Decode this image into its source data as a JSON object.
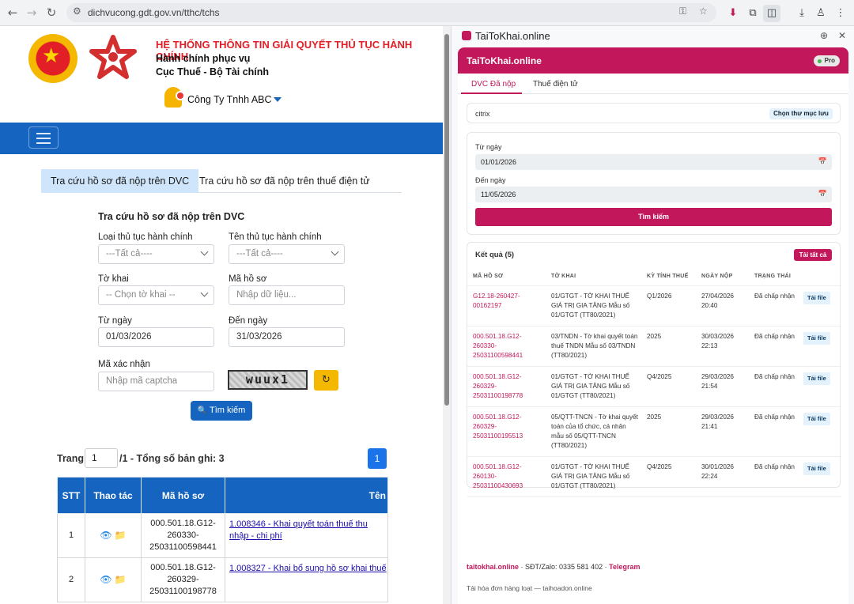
{
  "browser": {
    "url": "dichvucong.gdt.gov.vn/tthc/tchs"
  },
  "site": {
    "title": "HỆ THỐNG THÔNG TIN GIẢI QUYẾT THỦ TỤC HÀNH CHÍNH",
    "subtitle": "Hành chính phục vụ",
    "org": "Cục Thuế - Bộ Tài chính",
    "company": "Công Ty Tnhh ABC",
    "emblem_star": "★"
  },
  "tabs": {
    "tab1": "Tra cứu hồ sơ đã nộp trên DVC",
    "tab2": "Tra cứu hồ sơ đã nộp trên thuế điện tử"
  },
  "form": {
    "title": "Tra cứu hồ sơ đã nộp trên DVC",
    "loai_label": "Loại thủ tục hành chính",
    "loai_value": "---Tất cả----",
    "ten_label": "Tên thủ tục hành chính",
    "ten_value": "---Tất cả----",
    "tokhai_label": "Tờ khai",
    "tokhai_value": "-- Chọn tờ khai --",
    "mahs_label": "Mã hồ sơ",
    "mahs_placeholder": "Nhập dữ liệu...",
    "tungay_label": "Từ ngày",
    "tungay_value": "01/03/2026",
    "denngay_label": "Đến ngày",
    "denngay_value": "31/03/2026",
    "captcha_label": "Mã xác nhận",
    "captcha_placeholder": "Nhập mã captcha",
    "captcha_image": "wuux1",
    "refresh_icon": "↻",
    "search_icon": "🔍",
    "search_label": "Tìm kiếm"
  },
  "pager": {
    "trang": "Trang",
    "page": "1",
    "total_text": "/1 - Tổng số bản ghi: 3",
    "button": "1"
  },
  "results": {
    "headers": [
      "STT",
      "Thao tác",
      "Mã hồ sơ",
      "Tên"
    ],
    "view_icon": "👁",
    "folder_icon": "📁",
    "rows": [
      {
        "stt": "1",
        "code": "000.501.18.G12-260330-25031100598441",
        "name": "1.008346 - Khai quyết toán thuế thu nhập - chi phí"
      },
      {
        "stt": "2",
        "code": "000.501.18.G12-260329-25031100198778",
        "name": "1.008327 - Khai bổ sung hồ sơ khai thuế"
      }
    ]
  },
  "extension": {
    "window_title": "TaiToKhai.online",
    "pin_icon": "⊕",
    "close_icon": "✕",
    "header": "TaiToKhai.online",
    "badge": "Pro",
    "tab1": "DVC Đã nộp",
    "tab2": "Thuế điện tử",
    "folder_name": "citrix",
    "choose_folder": "Chọn thư mục lưu",
    "from_label": "Từ ngày",
    "from_value": "01/01/2026",
    "to_label": "Đến ngày",
    "to_value": "11/05/2026",
    "calendar_icon": "📅",
    "search_button": "Tìm kiếm",
    "results_title": "Kết quả (5)",
    "download_all": "Tải tất cả",
    "columns": [
      "MÃ HỒ SƠ",
      "TỜ KHAI",
      "KỲ TÍNH THUẾ",
      "NGÀY NỘP",
      "TRẠNG THÁI"
    ],
    "download_label": "Tải file",
    "rows": [
      {
        "code": "G12.18-260427-00162197",
        "form": "01/GTGT - TỜ KHAI THUẾ GIÁ TRỊ GIA TĂNG Mẫu số 01/GTGT (TT80/2021)",
        "period": "Q1/2026",
        "date": "27/04/2026 20:40",
        "status": "Đã chấp nhận"
      },
      {
        "code": "000.501.18.G12-260330-25031100598441",
        "form": "03/TNDN - Tờ khai quyết toán thuế TNDN Mẫu số 03/TNDN (TT80/2021)",
        "period": "2025",
        "date": "30/03/2026 22:13",
        "status": "Đã chấp nhận"
      },
      {
        "code": "000.501.18.G12-260329-25031100198778",
        "form": "01/GTGT - TỜ KHAI THUẾ GIÁ TRỊ GIA TĂNG Mẫu số 01/GTGT (TT80/2021)",
        "period": "Q4/2025",
        "date": "29/03/2026 21:54",
        "status": "Đã chấp nhận"
      },
      {
        "code": "000.501.18.G12-260329-25031100195513",
        "form": "05/QTT-TNCN - Tờ khai quyết toán của tổ chức, cá nhân mẫu số 05/QTT-TNCN (TT80/2021)",
        "period": "2025",
        "date": "29/03/2026 21:41",
        "status": "Đã chấp nhận"
      },
      {
        "code": "000.501.18.G12-260130-25031100430693",
        "form": "01/GTGT - TỜ KHAI THUẾ GIÁ TRỊ GIA TĂNG Mẫu số 01/GTGT (TT80/2021)",
        "period": "Q4/2025",
        "date": "30/01/2026 22:24",
        "status": "Đã chấp nhận"
      }
    ],
    "footer_site": "taitokhai.online",
    "footer_phone": "· SĐT/Zalo: 0335 581 402 ·",
    "footer_telegram": "Telegram",
    "footer_note": "Tải hóa đơn hàng loạt — taihoadon.online"
  },
  "colors": {
    "brand_blue": "#1565c0",
    "brand_pink": "#c2185b",
    "title_red": "#e21e26"
  }
}
